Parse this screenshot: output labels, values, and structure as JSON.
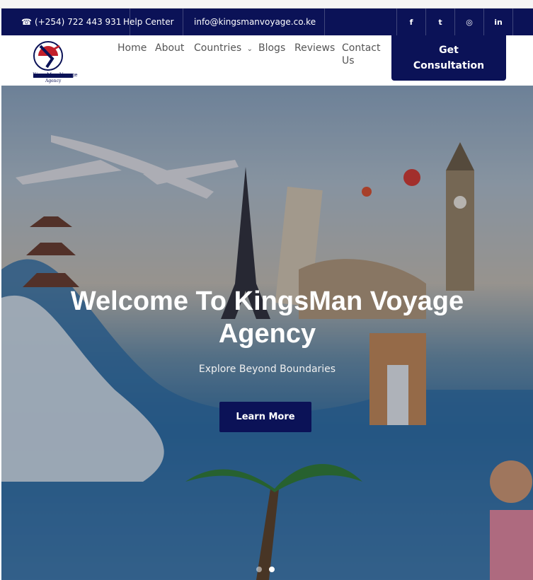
{
  "topbar": {
    "phone": "(+254) 722 443 931",
    "help": "Help Center",
    "email": "info@kingsmanvoyage.co.ke",
    "social": [
      {
        "icon": "facebook-icon",
        "glyph": "f"
      },
      {
        "icon": "twitter-icon",
        "glyph": "t"
      },
      {
        "icon": "instagram-icon",
        "glyph": "◎"
      },
      {
        "icon": "linkedin-icon",
        "glyph": "in"
      }
    ]
  },
  "nav": {
    "logo_text": "KingsMan Voyage",
    "logo_sub": "Agency",
    "items": [
      "Home",
      "About",
      "Countries",
      "Blogs",
      "Reviews",
      "Contact",
      "Us"
    ],
    "cta_line1": "Get",
    "cta_line2": "Consultation"
  },
  "hero": {
    "title_line1": "Welcome To KingsMan Voyage",
    "title_line2": "Agency",
    "subtitle": "Explore Beyond Boundaries",
    "button": "Learn More"
  },
  "colors": {
    "brand": "#0b1257",
    "white": "#ffffff"
  }
}
